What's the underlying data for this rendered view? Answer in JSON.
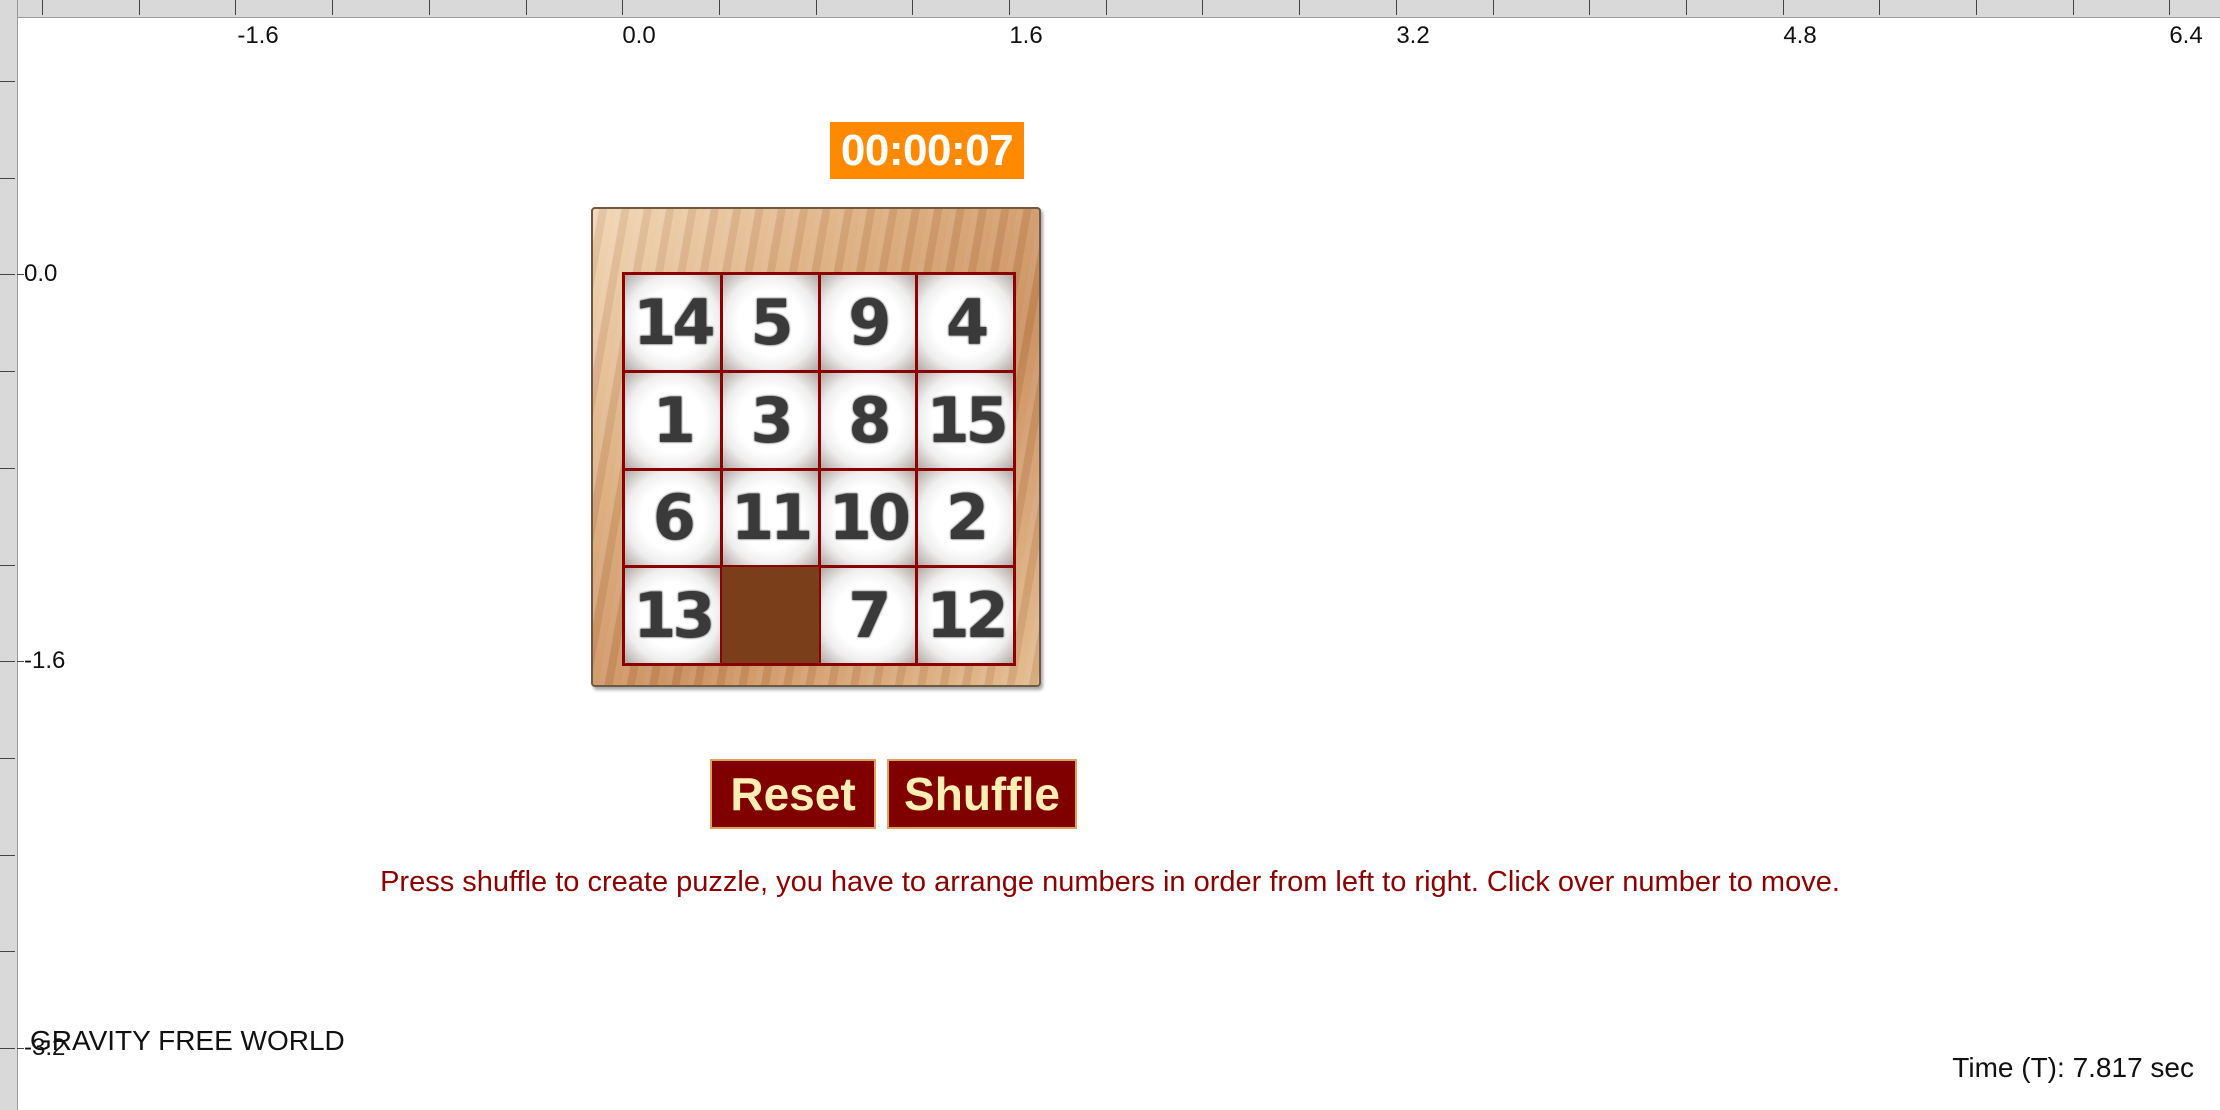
{
  "ruler": {
    "x_ticks": [
      "-1.6",
      "0.0",
      "1.6",
      "3.2",
      "4.8",
      "6.4"
    ],
    "y_ticks": [
      "0.0",
      "-1.6",
      "-3.2"
    ]
  },
  "timer": "00:00:07",
  "puzzle": {
    "tiles": [
      "14",
      "5",
      "9",
      "4",
      "1",
      "3",
      "8",
      "15",
      "6",
      "11",
      "10",
      "2",
      "13",
      "",
      "7",
      "12"
    ]
  },
  "buttons": {
    "reset": "Reset",
    "shuffle": "Shuffle"
  },
  "instructions": "Press shuffle to create puzzle, you have to arrange numbers in order from left to right. Click over number to move.",
  "world_label": "GRAVITY FREE WORLD",
  "time_readout": "Time (T): 7.817 sec",
  "colors": {
    "timer_bg": "#ff8a00",
    "button_bg": "#800000",
    "button_text": "#fdeeb5",
    "instruction_text": "#8b0000"
  }
}
